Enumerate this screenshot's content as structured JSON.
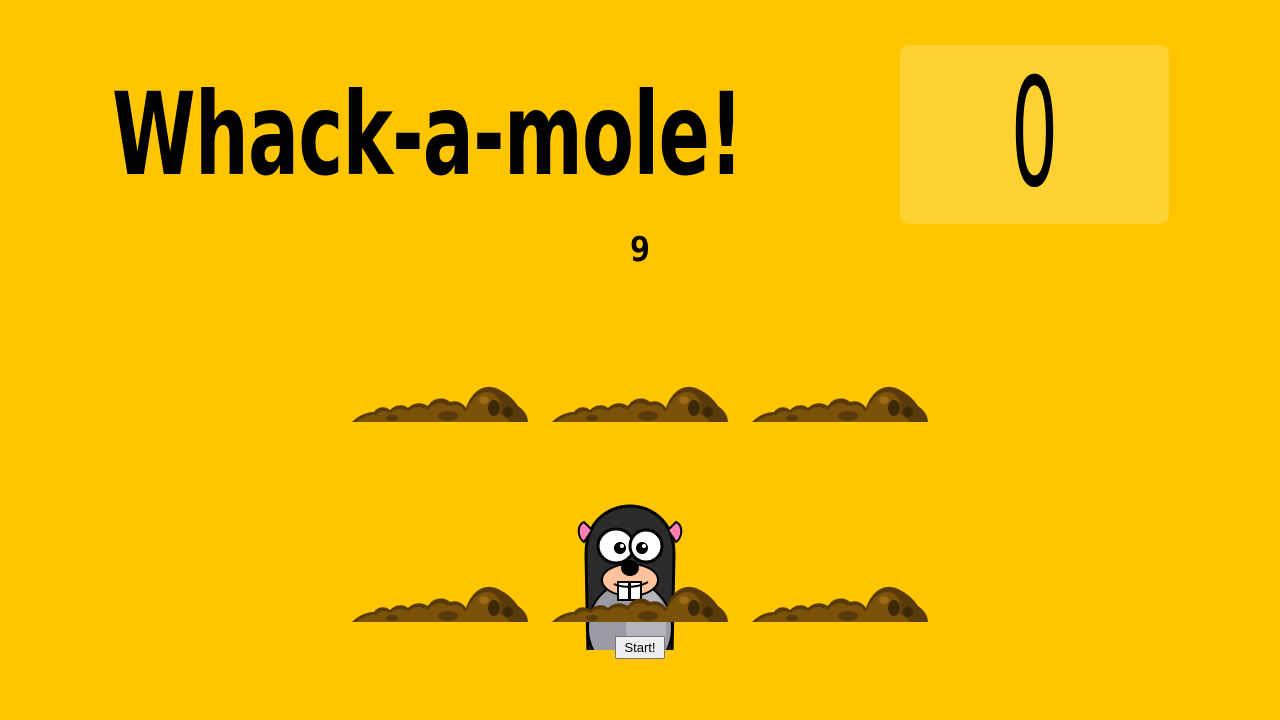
{
  "game": {
    "title": "Whack-a-mole!",
    "score": "0",
    "timer": "9",
    "start_label": "Start!"
  },
  "holes": [
    {
      "mole_up": false
    },
    {
      "mole_up": false
    },
    {
      "mole_up": false
    },
    {
      "mole_up": false
    },
    {
      "mole_up": true
    },
    {
      "mole_up": false
    }
  ],
  "colors": {
    "background": "#ffc600",
    "dirt_dark": "#5a3a0a",
    "dirt_light": "#7a5209",
    "mole_body": "#2b2b2b"
  }
}
